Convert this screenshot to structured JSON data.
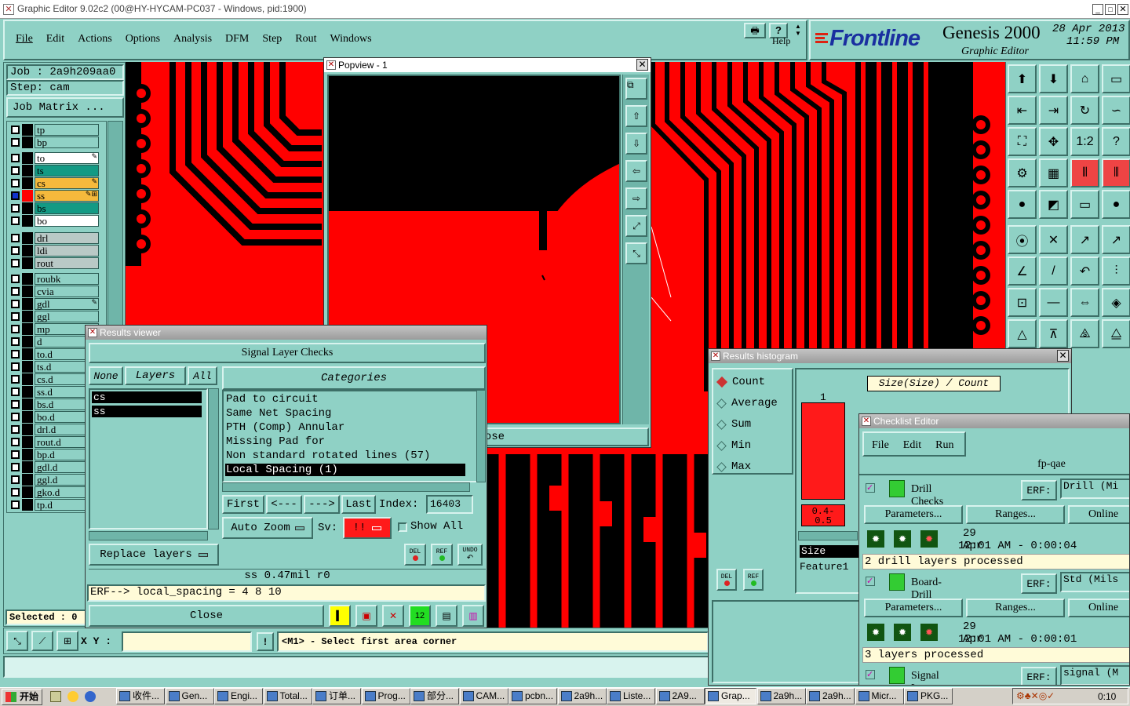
{
  "window": {
    "title": "Graphic Editor 9.02c2 (00@HY-HYCAM-PC037 - Windows, pid:1900)"
  },
  "menu": {
    "items": [
      "File",
      "Edit",
      "Actions",
      "Options",
      "Analysis",
      "DFM",
      "Step",
      "Rout",
      "Windows"
    ],
    "help": "Help"
  },
  "brand": {
    "logo": "Frontline",
    "product": "Genesis 2000",
    "subtitle": "Graphic Editor",
    "date": "28 Apr 2013",
    "time": "11:59 PM"
  },
  "job": {
    "job_label": "Job : 2a9h209aa0",
    "step_label": "Step: cam",
    "matrix_button": "Job Matrix ..."
  },
  "layers": [
    {
      "name": "tp",
      "color": "#8fd1c5",
      "sym": ""
    },
    {
      "name": "bp",
      "color": "#8fd1c5",
      "sym": ""
    },
    {
      "name": "to",
      "color": "#ffffff",
      "sym": "✎"
    },
    {
      "name": "ts",
      "color": "#139a84",
      "sym": ""
    },
    {
      "name": "cs",
      "color": "#f5b93c",
      "sym": "✎"
    },
    {
      "name": "ss",
      "color": "#f5b93c",
      "sym": "✎⊞"
    },
    {
      "name": "bs",
      "color": "#139a84",
      "sym": ""
    },
    {
      "name": "bo",
      "color": "#ffffff",
      "sym": ""
    },
    {
      "name": "drl",
      "color": "#b9c9c6",
      "sym": ""
    },
    {
      "name": "ldi",
      "color": "#b9c9c6",
      "sym": ""
    },
    {
      "name": "rout",
      "color": "#b9c9c6",
      "sym": ""
    },
    {
      "name": "roubk",
      "color": "#8fd1c5",
      "sym": ""
    },
    {
      "name": "cvia",
      "color": "#8fd1c5",
      "sym": ""
    },
    {
      "name": "gdl",
      "color": "#8fd1c5",
      "sym": "✎"
    },
    {
      "name": "ggl",
      "color": "#8fd1c5",
      "sym": ""
    },
    {
      "name": "mp",
      "color": "#8fd1c5",
      "sym": ""
    },
    {
      "name": "d",
      "color": "#8fd1c5",
      "sym": ""
    },
    {
      "name": "to.d",
      "color": "#8fd1c5",
      "sym": ""
    },
    {
      "name": "ts.d",
      "color": "#8fd1c5",
      "sym": ""
    },
    {
      "name": "cs.d",
      "color": "#8fd1c5",
      "sym": ""
    },
    {
      "name": "ss.d",
      "color": "#8fd1c5",
      "sym": ""
    },
    {
      "name": "bs.d",
      "color": "#8fd1c5",
      "sym": ""
    },
    {
      "name": "bo.d",
      "color": "#8fd1c5",
      "sym": ""
    },
    {
      "name": "drl.d",
      "color": "#8fd1c5",
      "sym": ""
    },
    {
      "name": "rout.d",
      "color": "#8fd1c5",
      "sym": ""
    },
    {
      "name": "bp.d",
      "color": "#8fd1c5",
      "sym": ""
    },
    {
      "name": "gdl.d",
      "color": "#8fd1c5",
      "sym": ""
    },
    {
      "name": "ggl.d",
      "color": "#8fd1c5",
      "sym": ""
    },
    {
      "name": "gko.d",
      "color": "#8fd1c5",
      "sym": ""
    },
    {
      "name": "tp.d",
      "color": "#8fd1c5",
      "sym": ""
    }
  ],
  "status": {
    "selected": "Selected : 0",
    "xy_label": "X Y :",
    "xy_value": "",
    "prompt": "<M1> - Select first area corner"
  },
  "results_viewer": {
    "title": "Results viewer",
    "header": "Signal Layer Checks",
    "none": "None",
    "layers": "Layers",
    "all": "All",
    "categories": "Categories",
    "layer_list": [
      "cs",
      "ss"
    ],
    "category_list": [
      "Pad to circuit",
      "Same Net Spacing",
      "PTH (Comp) Annular",
      "Missing Pad for",
      "Non standard rotated lines (57)",
      "Local Spacing (1)"
    ],
    "first": "First",
    "prev": "<---",
    "next": "--->",
    "last": "Last",
    "index_label": "Index:",
    "index_value": "16403",
    "auto_zoom": "Auto Zoom",
    "sv_label": "Sv:",
    "sv_value": "!!",
    "show_all": "Show All",
    "replace_layers": "Replace layers",
    "info": "ss 0.47mil  r0",
    "erf": "ERF--> local_spacing = 4 8 10",
    "close": "Close",
    "del": "DEL",
    "ref": "REF",
    "undo": "UNDO"
  },
  "popview": {
    "title": "Popview - 1",
    "close": "Close"
  },
  "histogram": {
    "title": "Results histogram",
    "options": [
      "Count",
      "Average",
      "Sum",
      "Min",
      "Max"
    ],
    "selected": "Count",
    "header": "Size(Size) / Count",
    "bar_count": "1",
    "bar_range": "0.4- 0.5",
    "size_label": "Size",
    "feature_label": "Feature1",
    "del": "DEL",
    "ref": "REF"
  },
  "checklist": {
    "title": "Checklist Editor",
    "menu": [
      "File",
      "Edit",
      "Run"
    ],
    "name": "fp-qae",
    "checks": [
      {
        "name": "Drill Checks",
        "erf": "ERF:",
        "erf_value": "Drill (Mi",
        "date": "29 Apr 2013",
        "time": "12:01 AM - 0:00:04",
        "summary": "2 drill layers processed"
      },
      {
        "name": "Board-Drill Checks",
        "erf": "ERF:",
        "erf_value": "Std (Mils",
        "date": "29 Apr 2013",
        "time": "12:01 AM - 0:00:01",
        "summary": "3 layers processed"
      },
      {
        "name": "Signal Layer Checks",
        "erf": "ERF:",
        "erf_value": "signal (M",
        "date": "",
        "time": "",
        "summary": ""
      }
    ],
    "parameters": "Parameters...",
    "ranges": "Ranges...",
    "online": "Online"
  },
  "taskbar": {
    "start": "开始",
    "items": [
      "收件...",
      "Gen...",
      "Engi...",
      "Total...",
      "订单...",
      "Prog...",
      "部分...",
      "CAM...",
      "pcbn...",
      "2a9h...",
      "Liste...",
      "2A9...",
      "Grap...",
      "2a9h...",
      "2a9h...",
      "Micr...",
      "PKG..."
    ],
    "clock": "0:10"
  },
  "colors": {
    "board_red": "#ff0000",
    "teal": "#8fd1c5",
    "accent_yellow": "#fffbd8"
  }
}
